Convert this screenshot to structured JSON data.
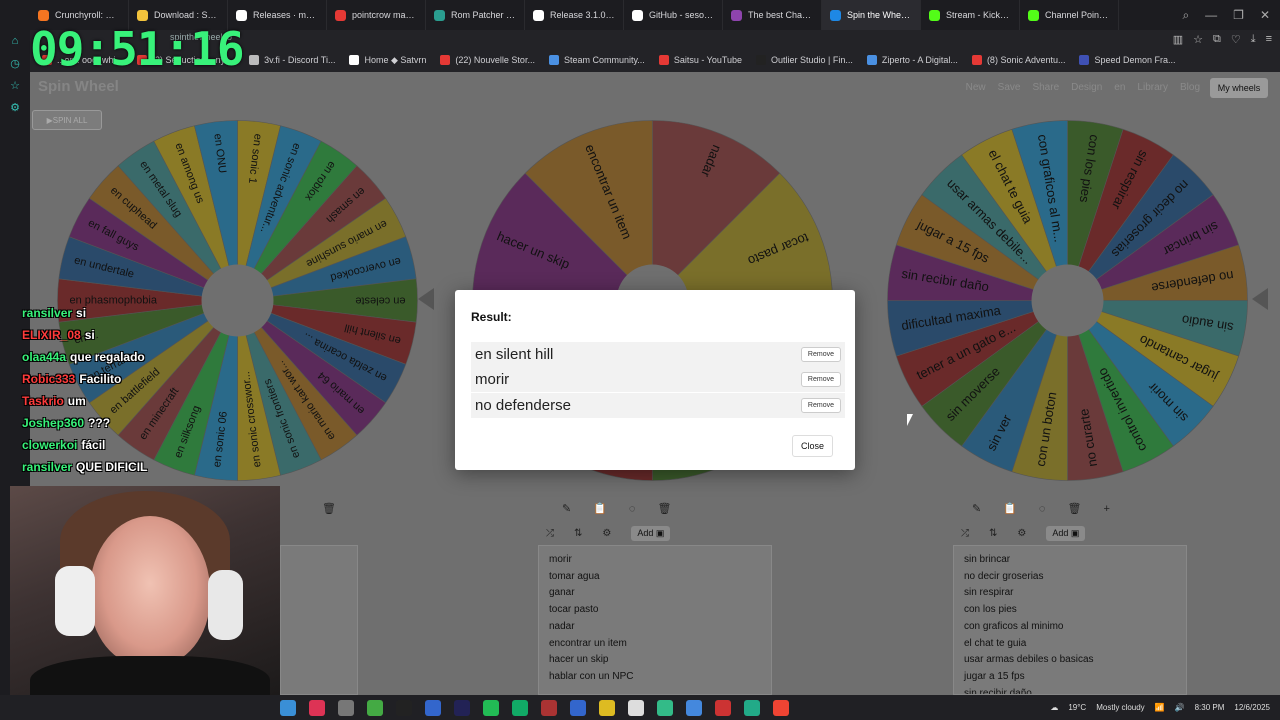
{
  "browser": {
    "tabs": [
      {
        "label": "Crunchyroll: Watc",
        "color": "#f47521"
      },
      {
        "label": "Download : Super",
        "color": "#f3c33c"
      },
      {
        "label": "Releases · marco",
        "color": "#ffffff"
      },
      {
        "label": "pointcrow makes",
        "color": "#e53935"
      },
      {
        "label": "Rom Patcher JS",
        "color": "#2a9d8f"
      },
      {
        "label": "Release 3.1.0 [be",
        "color": "#ffffff"
      },
      {
        "label": "GitHub - sesouth",
        "color": "#ffffff"
      },
      {
        "label": "The best ChatBot",
        "color": "#8e44ad"
      },
      {
        "label": "Spin the Wheel - Free an",
        "color": "#1e88e5",
        "active": true
      },
      {
        "label": "Stream - Kick Da",
        "color": "#53fc18"
      },
      {
        "label": "Channel Points -",
        "color": "#53fc18"
      }
    ],
    "url": "spinthewheel.io",
    "bookmarks": [
      {
        "label": "...ont. ooo_whi...",
        "color": "#e53935"
      },
      {
        "label": "(2) Seduction – nyt...",
        "color": "#e53935"
      },
      {
        "label": "3v.fi - Discord Ti...",
        "color": "#bbbbbb"
      },
      {
        "label": "Home ◆ Satvrn",
        "color": "#ffffff"
      },
      {
        "label": "(22) Nouvelle Stor...",
        "color": "#e53935"
      },
      {
        "label": "Steam Community...",
        "color": "#4a90e2"
      },
      {
        "label": "Saitsu - YouTube",
        "color": "#e53935"
      },
      {
        "label": "Outlier Studio | Fin...",
        "color": "#222222"
      },
      {
        "label": "Ziperto - A Digital...",
        "color": "#4a90e2"
      },
      {
        "label": "(8) Sonic Adventu...",
        "color": "#e53935"
      },
      {
        "label": "Speed Demon Fra...",
        "color": "#3f51b5"
      }
    ]
  },
  "overlay": {
    "clock": "09:51:16",
    "chat": [
      {
        "user": "ransilver",
        "color": "#38f27a",
        "msg": "si"
      },
      {
        "user": "ELIXIR_08",
        "color": "#ff3b3b",
        "msg": "si"
      },
      {
        "user": "olaa44a",
        "color": "#38f27a",
        "msg": "que regalado"
      },
      {
        "user": "Robic333",
        "color": "#ff3b3b",
        "msg": "Facilito"
      },
      {
        "user": "Taskrio",
        "color": "#ff3b3b",
        "msg": "um"
      },
      {
        "user": "Joshep360",
        "color": "#38f27a",
        "msg": "???"
      },
      {
        "user": "clowerkoi",
        "color": "#38f27a",
        "msg": "fácil"
      },
      {
        "user": "ransilver",
        "color": "#38f27a",
        "msg": "QUE DIFICIL"
      }
    ]
  },
  "app": {
    "logo": "Spin Wheel",
    "spin_all": "SPIN ALL",
    "nav": [
      "New",
      "Save",
      "Share",
      "Design",
      "en",
      "Library",
      "Blog"
    ],
    "my_wheels": "My wheels",
    "add_label": "Add",
    "wheels": [
      {
        "segments": [
          "en sonic 1",
          "en sonic adventur...",
          "en roblox",
          "en smash",
          "en mario sunshine",
          "en overcooked",
          "en celeste",
          "en silent hill",
          "en zelda ocarina ...",
          "en mario 64",
          "en mario kart wor...",
          "en sonic frontiers",
          "en sonic crosswor...",
          "en sonic 06",
          "en silksong",
          "en minecraft",
          "en battlefield",
          "en terraria",
          "en ...",
          "en phasmophobia",
          "en undertale",
          "en fall guys",
          "en cuphead",
          "en metal slug",
          "en among us",
          "en ONU"
        ]
      },
      {
        "segments": [
          "nadar",
          "tocar pasto",
          "ganar",
          "tomar agua",
          "morir",
          "hablar con un NPC",
          "hacer un skip",
          "encontrar un item"
        ]
      },
      {
        "segments": [
          "con los pies",
          "sin respirar",
          "no decir groserias",
          "sin brincar",
          "no defenderse",
          "sin audio",
          "jugar cantando",
          "sin morir",
          "control invertido",
          "no curarte",
          "con un boton",
          "sin ver",
          "sin moverse",
          "tener a un gato e...",
          "dificultad maxima",
          "sin recibir daño",
          "jugar a 15 fps",
          "usar armas debile...",
          "el chat te guia",
          "con graficos al m..."
        ]
      }
    ],
    "lists": [
      [
        "morir",
        "tomar agua",
        "ganar",
        "tocar pasto",
        "nadar",
        "encontrar un item",
        "hacer un skip",
        "hablar con un NPC"
      ],
      [
        "sin brincar",
        "no decir groserias",
        "sin respirar",
        "con los pies",
        "con graficos al minimo",
        "el chat te guia",
        "usar armas debiles o basicas",
        "jugar a 15 fps",
        "sin recibir daño"
      ]
    ]
  },
  "dialog": {
    "title": "Result:",
    "results": [
      "en silent hill",
      "morir",
      "no defenderse"
    ],
    "remove_label": "Remove",
    "close_label": "Close"
  },
  "taskbar": {
    "weather_temp": "19°C",
    "weather_desc": "Mostly cloudy",
    "time": "8:30 PM",
    "date": "12/6/2025"
  },
  "colors": {
    "segment_palette": [
      "#8a7a26",
      "#2a6a8a",
      "#2f7a3c",
      "#6a3a3a",
      "#7a6f2a",
      "#2a5a7a",
      "#3a5a2a",
      "#6a2a2a",
      "#2a4a6a",
      "#5a2a5a",
      "#7a5a2a",
      "#3a6a6a"
    ],
    "clock": "#38f27a"
  }
}
